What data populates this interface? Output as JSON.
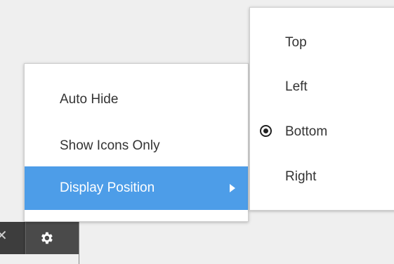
{
  "menu": {
    "items": [
      {
        "label": "Auto Hide"
      },
      {
        "label": "Show Icons Only"
      },
      {
        "label": "Display Position",
        "highlighted": true,
        "has_submenu": true
      }
    ],
    "highlight_color": "#4d9de8"
  },
  "submenu": {
    "items": [
      {
        "label": "Top",
        "selected": false
      },
      {
        "label": "Left",
        "selected": false
      },
      {
        "label": "Bottom",
        "selected": true
      },
      {
        "label": "Right",
        "selected": false
      }
    ]
  },
  "toolbar": {
    "buttons": [
      {
        "icon": "close-icon"
      },
      {
        "icon": "gear-icon"
      }
    ],
    "color": "#4a4a4a"
  }
}
